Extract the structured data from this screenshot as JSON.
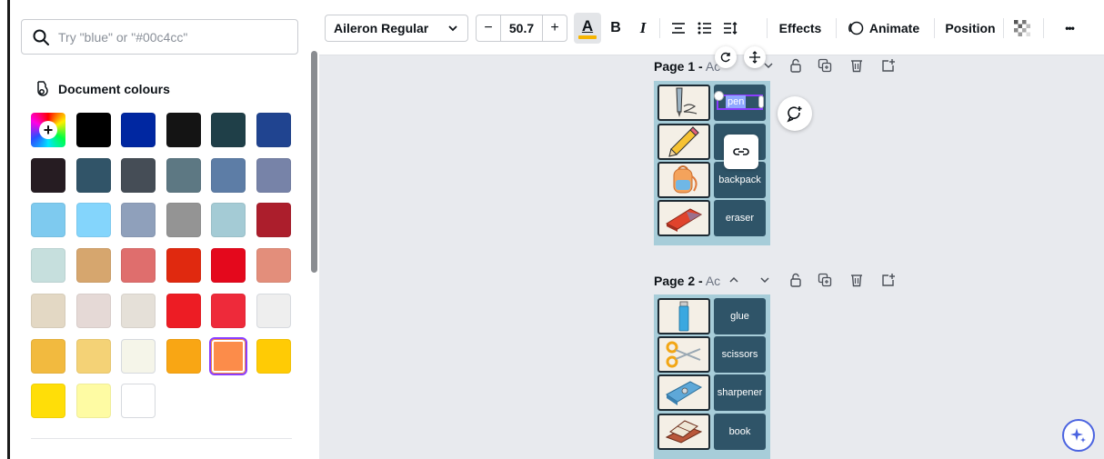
{
  "search": {
    "placeholder": "Try \"blue\" or \"#00c4cc\""
  },
  "document_colours": {
    "title": "Document colours",
    "add_icon": "plus-icon",
    "swatches": [
      "#000000",
      "#0027a1",
      "#141414",
      "#1f3f48",
      "#204490",
      "#261c22",
      "#315468",
      "#454d56",
      "#5d7883",
      "#5d7da6",
      "#7783a8",
      "#7ecaef",
      "#84d5fc",
      "#8fa0bb",
      "#949494",
      "#a4cbd5",
      "#ac1e2c",
      "#c6dfdd",
      "#d6a66e",
      "#df6e6d",
      "#e0290f",
      "#e4081c",
      "#e38e7b",
      "#e3d8c4",
      "#e5d9d6",
      "#e5e0d8",
      "#ed1c24",
      "#ee2a3a",
      "#eeeeee",
      "#f2ba3f",
      "#f4d276",
      "#f5f5e9",
      "#f9a614",
      "#fc8c4a",
      "#ffcb05",
      "#ffde08",
      "#fefba3",
      "#ffffff"
    ],
    "selected_index": 33
  },
  "toolbar": {
    "font": "Aileron Regular",
    "font_size": "50.7",
    "minus": "−",
    "plus": "+",
    "text_color_letter": "A",
    "text_color": "#f5b400",
    "bold": "B",
    "italic": "I",
    "effects": "Effects",
    "animate": "Animate",
    "position": "Position",
    "more": "•••"
  },
  "pages": [
    {
      "label": "Page 1 -",
      "sub": "Ac",
      "words": [
        "pen",
        "",
        "backpack",
        "eraser"
      ]
    },
    {
      "label": "Page 2 -",
      "sub": "Ac",
      "words": [
        "glue",
        "scissors",
        "sharpener",
        "book"
      ]
    }
  ]
}
